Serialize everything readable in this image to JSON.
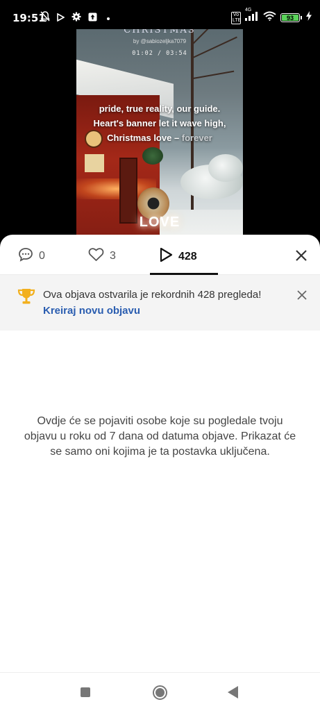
{
  "status_bar": {
    "time": "19:51",
    "battery_level": "93",
    "network": "4G",
    "volte": "Vo LTE"
  },
  "video": {
    "title": "CHRISTMAS",
    "author": "by @sabiozeljka7079",
    "time": "01:02 / 03:54",
    "lyrics_line1": "pride, true reality, our guide.",
    "lyrics_line2": "Heart's banner let it wave high,",
    "lyrics_line3a": "Christmas love – ",
    "lyrics_line3b": "forever",
    "overlay_word": "LOVE"
  },
  "tabs": {
    "comments_count": "0",
    "likes_count": "3",
    "views_count": "428"
  },
  "banner": {
    "message": "Ova objava ostvarila je rekordnih 428 pregleda!",
    "link": "Kreiraj novu objavu"
  },
  "empty_state": {
    "message": "Ovdje će se pojaviti osobe koje su pogledale tvoju objavu u roku od 7 dana od datuma objave. Prikazat će se samo oni kojima je ta postavka uključena."
  },
  "colors": {
    "accent_link": "#2a5db0",
    "trophy": "#f2b01e",
    "battery": "#5ad35a"
  }
}
